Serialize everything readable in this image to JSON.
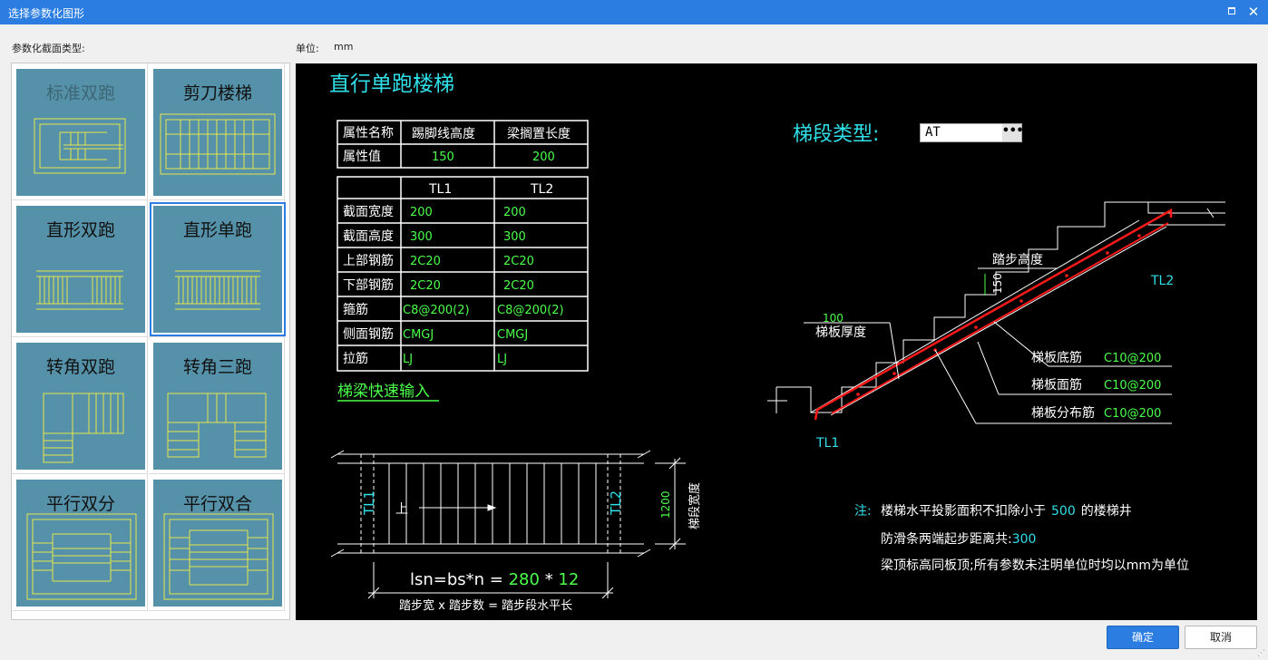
{
  "window": {
    "title": "选择参数化图形",
    "maximize_icon": "maximize-icon",
    "close_icon": "close-icon"
  },
  "left_panel": {
    "label": "参数化截面类型:",
    "tiles": [
      {
        "name": "标准双跑",
        "selected": false,
        "dimmed": true
      },
      {
        "name": "剪刀楼梯",
        "selected": false,
        "dimmed": false
      },
      {
        "name": "直形双跑",
        "selected": false,
        "dimmed": false
      },
      {
        "name": "直形单跑",
        "selected": true,
        "dimmed": false
      },
      {
        "name": "转角双跑",
        "selected": false,
        "dimmed": false
      },
      {
        "name": "转角三跑",
        "selected": false,
        "dimmed": false
      },
      {
        "name": "平行双分",
        "selected": false,
        "dimmed": false
      },
      {
        "name": "平行双合",
        "selected": false,
        "dimmed": false
      }
    ]
  },
  "unit": {
    "label": "单位:",
    "value": "mm"
  },
  "canvas": {
    "title": "直行单跑楼梯",
    "attr_table": {
      "headers": [
        "属性名称",
        "踢脚线高度",
        "梁搁置长度"
      ],
      "row_label": "属性值",
      "values": [
        "150",
        "200"
      ]
    },
    "beam_table": {
      "headers": [
        "",
        "TL1",
        "TL2"
      ],
      "rows": [
        [
          "截面宽度",
          "200",
          "200"
        ],
        [
          "截面高度",
          "300",
          "300"
        ],
        [
          "上部钢筋",
          "2C20",
          "2C20"
        ],
        [
          "下部钢筋",
          "2C20",
          "2C20"
        ],
        [
          "箍筋",
          "C8@200(2)",
          "C8@200(2)"
        ],
        [
          "侧面钢筋",
          "CMGJ",
          "CMGJ"
        ],
        [
          "拉筋",
          "LJ",
          "LJ"
        ]
      ]
    },
    "quick_input_link": "梯梁快速输入",
    "segment_type": {
      "label": "梯段类型:",
      "value": "AT",
      "more_button": "•••"
    },
    "section": {
      "step_height_label": "踏步高度",
      "step_height_value": "150",
      "slab_thickness_label": "梯板厚度",
      "slab_thickness_value": "100",
      "bottom_rebar": {
        "label": "梯板底筋",
        "value": "C10@200"
      },
      "top_rebar": {
        "label": "梯板面筋",
        "value": "C10@200"
      },
      "dist_rebar": {
        "label": "梯板分布筋",
        "value": "C10@200"
      },
      "tl1": "TL1",
      "tl2": "TL2"
    },
    "plan": {
      "tl1": "TL1",
      "tl2": "TL2",
      "up_label": "上",
      "width_value": "1200",
      "width_label": "梯段宽度",
      "formula_prefix": "lsn=bs*n = ",
      "formula_bs": "280",
      "formula_times": " * ",
      "formula_n": "12",
      "formula_caption": "踏步宽 x 踏步数 = 踏步段水平长"
    },
    "notes": {
      "prefix": "注:",
      "line1_pre": "楼梯水平投影面积不扣除小于",
      "line1_value": "500",
      "line1_post": "的楼梯井",
      "line2_pre": "防滑条两端起步距离共:",
      "line2_value": "300",
      "line3": "梁顶标高同板顶;所有参数未注明单位时均以mm为单位"
    }
  },
  "buttons": {
    "ok": "确定",
    "cancel": "取消"
  },
  "colors": {
    "title_bar": "#2b7de1",
    "tile_bg": "#5591a8",
    "cad_yellow": "#e8e84a",
    "cad_cyan": "#2fe0e8",
    "cad_green": "#4bff4b",
    "cad_red": "#ff1a1a"
  }
}
